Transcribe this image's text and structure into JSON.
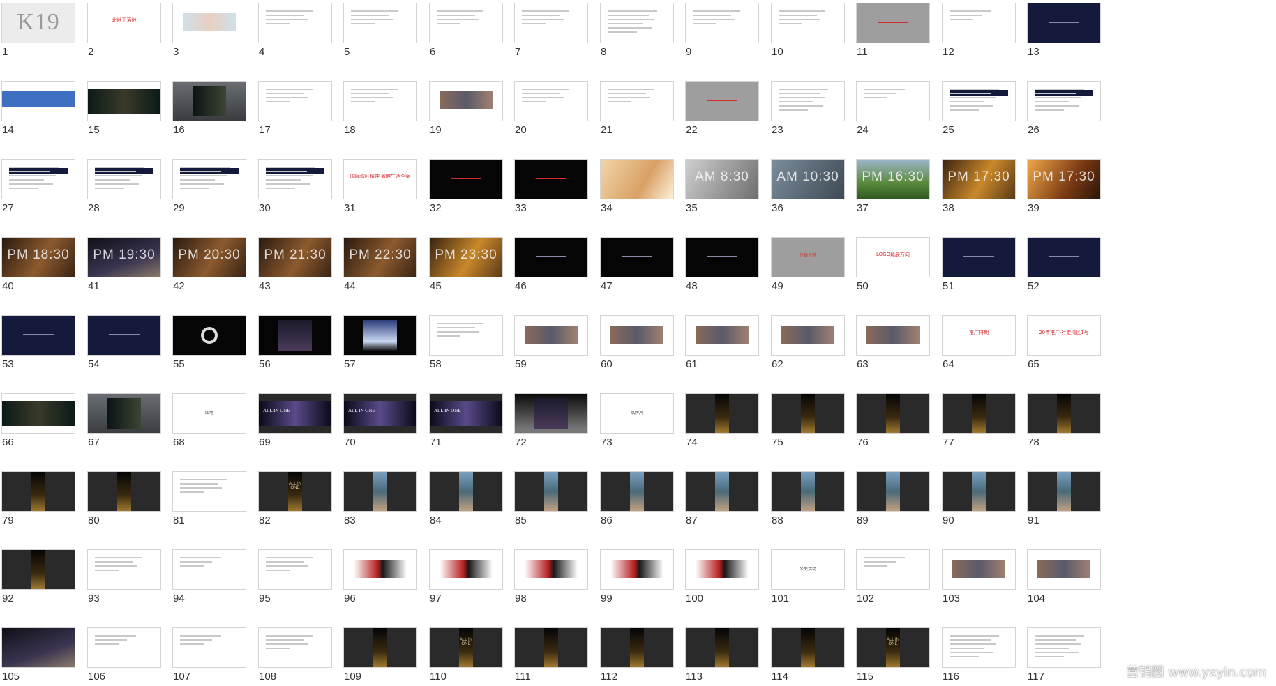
{
  "app": {
    "view": "slide-sorter"
  },
  "colors": {
    "accent_red": "#d62a2a",
    "navy": "#141a3c",
    "dark": "#2a2a2a",
    "gray": "#9e9e9e",
    "blue_band": "#3f6fc0"
  },
  "slides": [
    {
      "n": "1",
      "style": "k19",
      "text": "K19"
    },
    {
      "n": "2",
      "style": "white-title",
      "text": "北地王落地"
    },
    {
      "n": "3",
      "style": "white-map",
      "text": ""
    },
    {
      "n": "4",
      "style": "white-lines",
      "text": ""
    },
    {
      "n": "5",
      "style": "white-lines",
      "text": ""
    },
    {
      "n": "6",
      "style": "white-lines",
      "text": ""
    },
    {
      "n": "7",
      "style": "white-lines",
      "text": ""
    },
    {
      "n": "8",
      "style": "white-chart",
      "text": ""
    },
    {
      "n": "9",
      "style": "white-lines",
      "text": ""
    },
    {
      "n": "10",
      "style": "white-lines",
      "text": ""
    },
    {
      "n": "11",
      "style": "gray-red",
      "text": ""
    },
    {
      "n": "12",
      "style": "white-red",
      "text": ""
    },
    {
      "n": "13",
      "style": "navy-diagram",
      "text": ""
    },
    {
      "n": "14",
      "style": "blue-band",
      "text": ""
    },
    {
      "n": "15",
      "style": "dark-band",
      "text": ""
    },
    {
      "n": "16",
      "style": "billboard",
      "text": ""
    },
    {
      "n": "17",
      "style": "white-lines",
      "text": ""
    },
    {
      "n": "18",
      "style": "white-lines",
      "text": ""
    },
    {
      "n": "19",
      "style": "white-photos",
      "text": ""
    },
    {
      "n": "20",
      "style": "white-lines",
      "text": ""
    },
    {
      "n": "21",
      "style": "white-lines",
      "text": ""
    },
    {
      "n": "22",
      "style": "gray-red",
      "text": ""
    },
    {
      "n": "23",
      "style": "white-dense",
      "text": ""
    },
    {
      "n": "24",
      "style": "white-redline",
      "text": ""
    },
    {
      "n": "25",
      "style": "white-card",
      "text": ""
    },
    {
      "n": "26",
      "style": "white-card",
      "text": ""
    },
    {
      "n": "27",
      "style": "white-card",
      "text": ""
    },
    {
      "n": "28",
      "style": "white-card",
      "text": ""
    },
    {
      "n": "29",
      "style": "white-card",
      "text": ""
    },
    {
      "n": "30",
      "style": "white-card",
      "text": ""
    },
    {
      "n": "31",
      "style": "white-red",
      "text": "国际湾区精神 奢越生活全案"
    },
    {
      "n": "32",
      "style": "black-red",
      "text": ""
    },
    {
      "n": "33",
      "style": "black-red",
      "text": ""
    },
    {
      "n": "34",
      "style": "photo-warm",
      "text": ""
    },
    {
      "n": "35",
      "style": "photo-gray",
      "text": "AM 8:30"
    },
    {
      "n": "36",
      "style": "photo-blue",
      "text": "AM 10:30"
    },
    {
      "n": "37",
      "style": "photo-green",
      "text": "PM 16:30"
    },
    {
      "n": "38",
      "style": "photo-gold",
      "text": "PM 17:30"
    },
    {
      "n": "39",
      "style": "photo-sunset",
      "text": "PM 17:30"
    },
    {
      "n": "40",
      "style": "photo-amber",
      "text": "PM 18:30"
    },
    {
      "n": "41",
      "style": "photo-night",
      "text": "PM 19:30"
    },
    {
      "n": "42",
      "style": "photo-amber",
      "text": "PM 20:30"
    },
    {
      "n": "43",
      "style": "photo-amber",
      "text": "PM 21:30"
    },
    {
      "n": "44",
      "style": "photo-amber",
      "text": "PM 22:30"
    },
    {
      "n": "45",
      "style": "photo-gold",
      "text": "PM 23:30"
    },
    {
      "n": "46",
      "style": "black-text",
      "text": ""
    },
    {
      "n": "47",
      "style": "black-text",
      "text": ""
    },
    {
      "n": "48",
      "style": "black-text",
      "text": ""
    },
    {
      "n": "49",
      "style": "gray-red",
      "text": "传播主题"
    },
    {
      "n": "50",
      "style": "white-redline",
      "text": "LOGO延展方向"
    },
    {
      "n": "51",
      "style": "navy",
      "text": ""
    },
    {
      "n": "52",
      "style": "navy",
      "text": ""
    },
    {
      "n": "53",
      "style": "navy",
      "text": ""
    },
    {
      "n": "54",
      "style": "navy",
      "text": ""
    },
    {
      "n": "55",
      "style": "dark-ring",
      "text": ""
    },
    {
      "n": "56",
      "style": "dark-building",
      "text": ""
    },
    {
      "n": "57",
      "style": "dark-night",
      "text": ""
    },
    {
      "n": "58",
      "style": "white-lines",
      "text": ""
    },
    {
      "n": "59",
      "style": "white-arrow",
      "text": ""
    },
    {
      "n": "60",
      "style": "white-device",
      "text": ""
    },
    {
      "n": "61",
      "style": "white-photos",
      "text": ""
    },
    {
      "n": "62",
      "style": "white-photos",
      "text": ""
    },
    {
      "n": "63",
      "style": "white-photos",
      "text": ""
    },
    {
      "n": "64",
      "style": "white-red",
      "text": "推广排期"
    },
    {
      "n": "65",
      "style": "white-red",
      "text": "20年推广·行走湾区1号"
    },
    {
      "n": "66",
      "style": "white-band",
      "text": ""
    },
    {
      "n": "67",
      "style": "billboard",
      "text": ""
    },
    {
      "n": "68",
      "style": "white-lines",
      "text": "围墙"
    },
    {
      "n": "69",
      "style": "gray-band",
      "text": "ALL IN ONE"
    },
    {
      "n": "70",
      "style": "gray-band",
      "text": "ALL IN ONE"
    },
    {
      "n": "71",
      "style": "gray-band",
      "text": "ALL IN ONE"
    },
    {
      "n": "72",
      "style": "dark-gradient",
      "text": ""
    },
    {
      "n": "73",
      "style": "white-lines",
      "text": "品牌片"
    },
    {
      "n": "74",
      "style": "gray-poster",
      "text": ""
    },
    {
      "n": "75",
      "style": "gray-poster",
      "text": ""
    },
    {
      "n": "76",
      "style": "gray-poster",
      "text": ""
    },
    {
      "n": "77",
      "style": "gray-poster",
      "text": ""
    },
    {
      "n": "78",
      "style": "gray-poster",
      "text": ""
    },
    {
      "n": "79",
      "style": "gray-poster",
      "text": ""
    },
    {
      "n": "80",
      "style": "gray-poster",
      "text": ""
    },
    {
      "n": "81",
      "style": "white-lines",
      "text": ""
    },
    {
      "n": "82",
      "style": "gray-poster",
      "text": "ALL IN ONE"
    },
    {
      "n": "83",
      "style": "gray-photo",
      "text": ""
    },
    {
      "n": "84",
      "style": "gray-photo",
      "text": ""
    },
    {
      "n": "85",
      "style": "gray-photo",
      "text": ""
    },
    {
      "n": "86",
      "style": "gray-photo",
      "text": ""
    },
    {
      "n": "87",
      "style": "gray-photo",
      "text": ""
    },
    {
      "n": "88",
      "style": "gray-photo",
      "text": ""
    },
    {
      "n": "89",
      "style": "gray-photo",
      "text": ""
    },
    {
      "n": "90",
      "style": "gray-photo",
      "text": ""
    },
    {
      "n": "91",
      "style": "gray-photo",
      "text": ""
    },
    {
      "n": "92",
      "style": "gray-poster",
      "text": ""
    },
    {
      "n": "93",
      "style": "white-lines",
      "text": ""
    },
    {
      "n": "94",
      "style": "white-red",
      "text": ""
    },
    {
      "n": "95",
      "style": "white-lines",
      "text": ""
    },
    {
      "n": "96",
      "style": "white-hero",
      "text": ""
    },
    {
      "n": "97",
      "style": "white-hero",
      "text": ""
    },
    {
      "n": "98",
      "style": "white-hero",
      "text": ""
    },
    {
      "n": "99",
      "style": "white-hero",
      "text": ""
    },
    {
      "n": "100",
      "style": "white-hero",
      "text": ""
    },
    {
      "n": "101",
      "style": "white-lines",
      "text": "公关活动"
    },
    {
      "n": "102",
      "style": "white-red",
      "text": ""
    },
    {
      "n": "103",
      "style": "white-photos",
      "text": ""
    },
    {
      "n": "104",
      "style": "white-photos",
      "text": ""
    },
    {
      "n": "105",
      "style": "photo-night",
      "text": ""
    },
    {
      "n": "106",
      "style": "white-red",
      "text": ""
    },
    {
      "n": "107",
      "style": "white-red",
      "text": ""
    },
    {
      "n": "108",
      "style": "white-lines",
      "text": ""
    },
    {
      "n": "109",
      "style": "gray-poster",
      "text": ""
    },
    {
      "n": "110",
      "style": "gray-poster",
      "text": "ALL IN ONE"
    },
    {
      "n": "111",
      "style": "gray-poster",
      "text": ""
    },
    {
      "n": "112",
      "style": "gray-poster",
      "text": ""
    },
    {
      "n": "113",
      "style": "gray-poster",
      "text": ""
    },
    {
      "n": "114",
      "style": "gray-poster",
      "text": ""
    },
    {
      "n": "115",
      "style": "gray-poster",
      "text": "ALL IN ONE"
    },
    {
      "n": "116",
      "style": "white-dense",
      "text": ""
    },
    {
      "n": "117",
      "style": "white-chart",
      "text": ""
    }
  ],
  "watermark": {
    "text": "营销圈 www.yxyin.com"
  }
}
